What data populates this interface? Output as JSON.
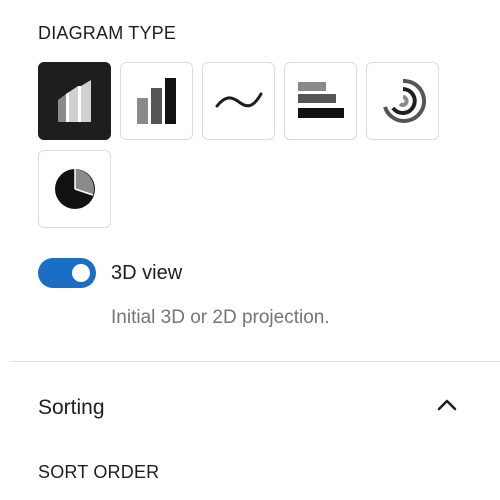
{
  "diagram_type": {
    "heading": "DIAGRAM TYPE",
    "options": [
      {
        "icon": "chart-3d-column-icon",
        "selected": true
      },
      {
        "icon": "bar-chart-icon",
        "selected": false
      },
      {
        "icon": "line-chart-icon",
        "selected": false
      },
      {
        "icon": "horizontal-bar-chart-icon",
        "selected": false
      },
      {
        "icon": "radial-bar-chart-icon",
        "selected": false
      },
      {
        "icon": "pie-chart-icon",
        "selected": false
      }
    ]
  },
  "view_toggle": {
    "label": "3D view",
    "checked": true,
    "help": "Initial 3D or 2D projection.",
    "accent_color": "#1a6fc4"
  },
  "sorting": {
    "title": "Sorting",
    "expanded": true,
    "sort_order_heading": "SORT ORDER"
  }
}
